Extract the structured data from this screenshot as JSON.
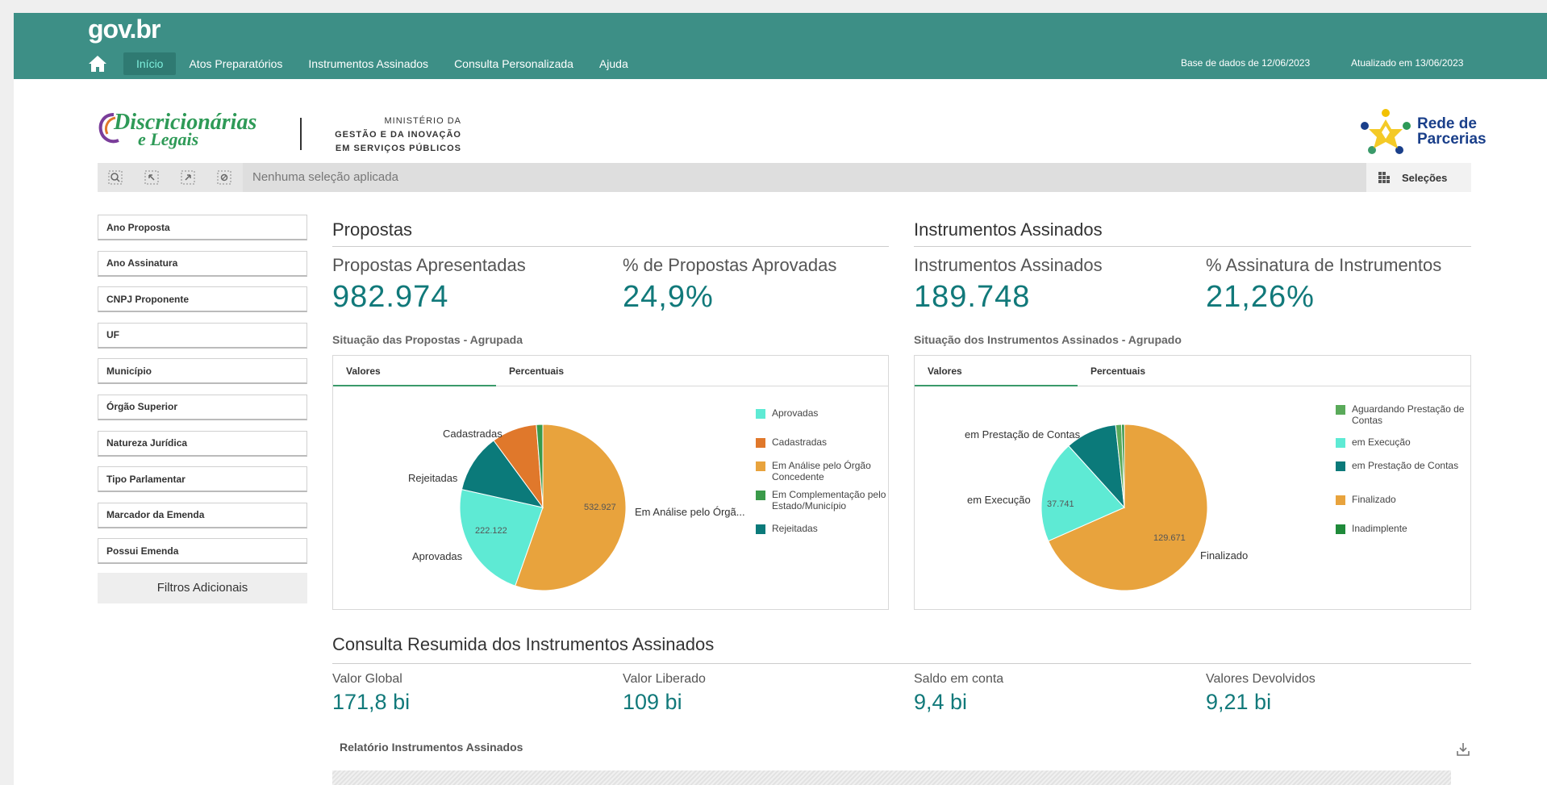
{
  "govbar": {
    "logo": "gov.br",
    "nav": [
      "Início",
      "Atos Preparatórios",
      "Instrumentos Assinados",
      "Consulta Personalizada",
      "Ajuda"
    ],
    "database_date": "Base de dados de 12/06/2023",
    "updated_date": "Atualizado em 13/06/2023"
  },
  "header": {
    "brand_line1": "Discricionárias",
    "brand_line2": "e Legais",
    "ministry_line1": "MINISTÉRIO DA",
    "ministry_line2": "GESTÃO E DA INOVAÇÃO",
    "ministry_line3": "EM SERVIÇOS PÚBLICOS",
    "partner_line1": "Rede de",
    "partner_line2": "Parcerias"
  },
  "selection_bar": {
    "message": "Nenhuma seleção aplicada",
    "selections_label": "Seleções"
  },
  "filters": {
    "items": [
      "Ano Proposta",
      "Ano Assinatura",
      "CNPJ Proponente",
      "UF",
      "Município",
      "Órgão Superior",
      "Natureza Jurídica",
      "Tipo Parlamentar",
      "Marcador da Emenda",
      "Possui Emenda"
    ],
    "more_label": "Filtros Adicionais"
  },
  "propostas": {
    "title": "Propostas",
    "kpi1_label": "Propostas Apresentadas",
    "kpi1_value": "982.974",
    "kpi2_label": "% de Propostas Aprovadas",
    "kpi2_value": "24,9%",
    "chart_title": "Situação das Propostas - Agrupada",
    "tab1": "Valores",
    "tab2": "Percentuais",
    "legend": [
      {
        "label": "Aprovadas",
        "color": "#5eead4"
      },
      {
        "label": "Cadastradas",
        "color": "#e0782b"
      },
      {
        "label": "Em Análise pelo Órgão Concedente",
        "color": "#e8a33d"
      },
      {
        "label": "Em Complementação pelo Estado/Município",
        "color": "#3a9a4a"
      },
      {
        "label": "Rejeitadas",
        "color": "#0b7a7a"
      }
    ],
    "labels": {
      "cadastradas": "Cadastradas",
      "rejeitadas": "Rejeitadas",
      "aprovadas": "Aprovadas",
      "analise": "Em Análise pelo Órgã...",
      "val_analise": "532.927",
      "val_aprovadas": "222.122"
    }
  },
  "instrumentos": {
    "title": "Instrumentos Assinados",
    "kpi1_label": "Instrumentos Assinados",
    "kpi1_value": "189.748",
    "kpi2_label": "% Assinatura de Instrumentos",
    "kpi2_value": "21,26%",
    "chart_title": "Situação dos Instrumentos Assinados - Agrupado",
    "tab1": "Valores",
    "tab2": "Percentuais",
    "legend": [
      {
        "label": "Aguardando Prestação de Contas",
        "color": "#5aaa5a"
      },
      {
        "label": "em Execução",
        "color": "#5eead4"
      },
      {
        "label": "em Prestação de Contas",
        "color": "#0b7a7a"
      },
      {
        "label": "Finalizado",
        "color": "#e8a33d"
      },
      {
        "label": "Inadimplente",
        "color": "#1f8a3a"
      }
    ],
    "labels": {
      "prestacao": "em Prestação de Contas",
      "execucao": "em Execução",
      "finalizado": "Finalizado",
      "val_execucao": "37.741",
      "val_finalizado": "129.671"
    }
  },
  "resumo": {
    "title": "Consulta Resumida dos Instrumentos Assinados",
    "items": [
      {
        "label": "Valor Global",
        "value": "171,8 bi"
      },
      {
        "label": "Valor Liberado",
        "value": "109 bi"
      },
      {
        "label": "Saldo em conta",
        "value": "9,4 bi"
      },
      {
        "label": "Valores Devolvidos",
        "value": "9,21 bi"
      }
    ],
    "report_title": "Relatório Instrumentos Assinados"
  },
  "chart_data": [
    {
      "type": "pie",
      "title": "Situação das Propostas - Agrupada",
      "categories": [
        "Em Análise pelo Órgão Concedente",
        "Aprovadas",
        "Rejeitadas",
        "Cadastradas",
        "Em Complementação pelo Estado/Município"
      ],
      "values": [
        532927,
        222122,
        110000,
        85000,
        12000
      ],
      "colors": [
        "#e8a33d",
        "#5eead4",
        "#0b7a7a",
        "#e0782b",
        "#3a9a4a"
      ]
    },
    {
      "type": "pie",
      "title": "Situação dos Instrumentos Assinados - Agrupado",
      "categories": [
        "Finalizado",
        "em Execução",
        "em Prestação de Contas",
        "Aguardando Prestação de Contas",
        "Inadimplente"
      ],
      "values": [
        129671,
        37741,
        19000,
        2200,
        1000
      ],
      "colors": [
        "#e8a33d",
        "#5eead4",
        "#0b7a7a",
        "#5aaa5a",
        "#1f8a3a"
      ]
    }
  ]
}
